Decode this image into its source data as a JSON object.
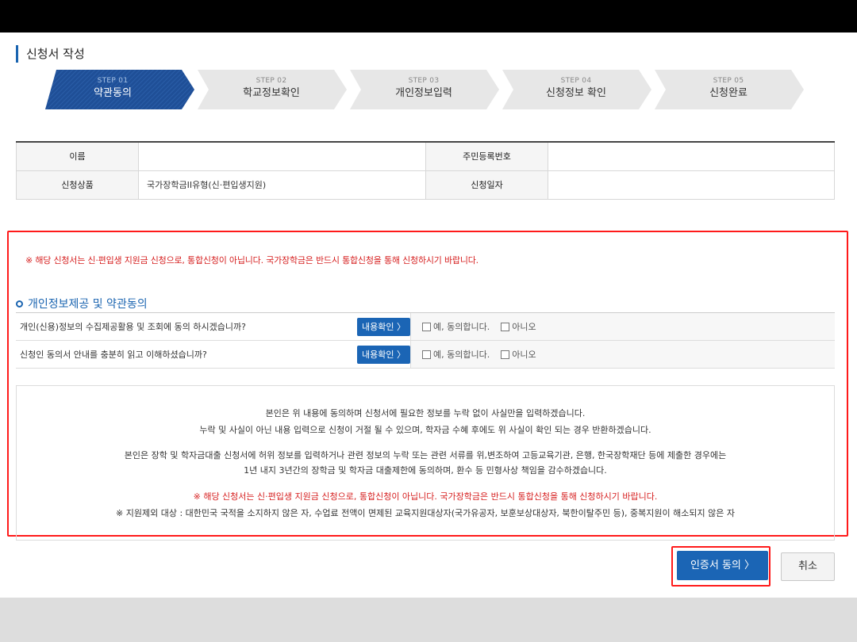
{
  "page": {
    "title": "신청서 작성"
  },
  "steps": [
    {
      "num": "STEP 01",
      "label": "약관동의",
      "active": true
    },
    {
      "num": "STEP 02",
      "label": "학교정보확인",
      "active": false
    },
    {
      "num": "STEP 03",
      "label": "개인정보입력",
      "active": false
    },
    {
      "num": "STEP 04",
      "label": "신청정보 확인",
      "active": false
    },
    {
      "num": "STEP 05",
      "label": "신청완료",
      "active": false
    }
  ],
  "info": {
    "name_label": "이름",
    "name_value": "",
    "rrn_label": "주민등록번호",
    "rrn_value": "",
    "product_label": "신청상품",
    "product_value": "국가장학금II유형(신·편입생지원)",
    "date_label": "신청일자",
    "date_value": ""
  },
  "notice_top": "※ 해당 신청서는 신·편입생 지원금 신청으로, 통합신청이 아닙니다. 국가장학금은 반드시 통합신청을 통해 신청하시기 바랍니다.",
  "agreement": {
    "section_title": "개인정보제공 및 약관동의",
    "rows": [
      {
        "question": "개인(신용)정보의 수집제공활용 및 조회에 동의 하시겠습니까?",
        "detail_button": "내용확인 〉",
        "yes": "예, 동의합니다.",
        "no": "아니오"
      },
      {
        "question": "신청인 동의서 안내를 충분히 읽고 이해하셨습니까?",
        "detail_button": "내용확인 〉",
        "yes": "예, 동의합니다.",
        "no": "아니오"
      }
    ]
  },
  "pledge": {
    "line1": "본인은 위 내용에 동의하며 신청서에 필요한 정보를 누락 없이 사실만을 입력하겠습니다.",
    "line2": "누락 및 사실이 아닌 내용 입력으로 신청이 거절 될 수 있으며, 학자금 수혜 후에도 위 사실이 확인 되는 경우 반환하겠습니다.",
    "line3": "본인은 장학 및 학자금대출 신청서에 허위 정보를 입력하거나 관련 정보의 누락 또는 관련 서류를 위,변조하여 고등교육기관, 은행, 한국장학재단 등에 제출한 경우에는",
    "line4": "1년 내지 3년간의 장학금 및 학자금 대출제한에 동의하며, 환수 등 민형사상 책임을 감수하겠습니다.",
    "line5": "※ 해당 신청서는 신·편입생 지원금 신청으로, 통합신청이 아닙니다. 국가장학금은 반드시 통합신청을 통해 신청하시기 바랍니다.",
    "line6": "※ 지원제외 대상 : 대한민국 국적을 소지하지 않은 자, 수업료 전액이 면제된 교육지원대상자(국가유공자, 보훈보상대상자, 북한이탈주민 등), 중복지원이 해소되지 않은 자"
  },
  "buttons": {
    "cert_agree": "인증서 동의 〉",
    "cancel": "취소"
  },
  "colors": {
    "primary": "#1b65b5",
    "highlight": "#ff1a1a",
    "notice": "#d61f1f"
  }
}
